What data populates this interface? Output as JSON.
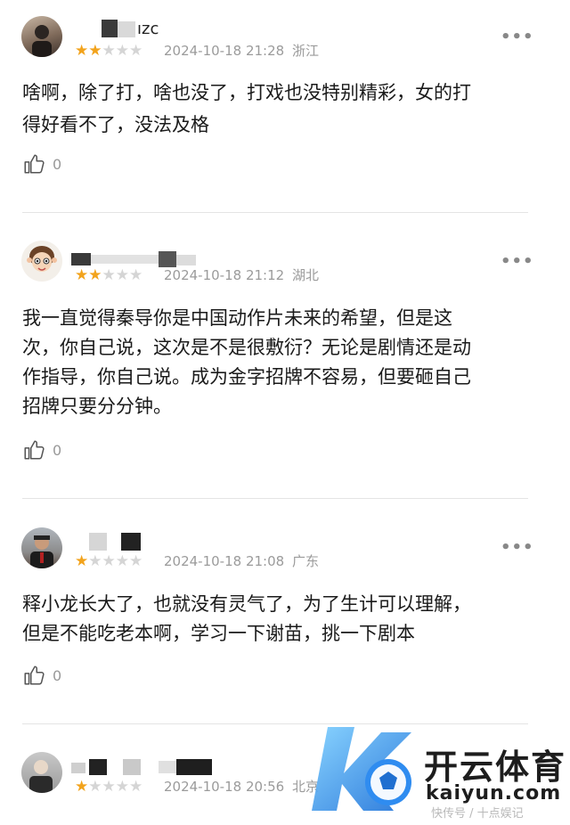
{
  "comments": [
    {
      "avatar": "avatar-photo",
      "stars": 2,
      "name_suffix": "ızc",
      "timestamp": "2024-10-18 21:28",
      "location": "浙江",
      "text_lines": [
        "啥啊，除了打，啥也没了，打戏也没特别精彩，女的打",
        "得好看不了，没法及格"
      ],
      "likes": "0"
    },
    {
      "avatar": "avatar-cartoon",
      "stars": 2,
      "name_suffix": "",
      "timestamp": "2024-10-18 21:12",
      "location": "湖北",
      "text_lines": [
        "我一直觉得秦导你是中国动作片未来的希望，但是这",
        "次，你自己说，这次是不是很敷衍？无论是剧情还是动",
        "作指导，你自己说。成为金字招牌不容易，但要砸自己",
        "招牌只要分分钟。"
      ],
      "likes": "0"
    },
    {
      "avatar": "avatar-photo",
      "stars": 1,
      "name_suffix": "",
      "timestamp": "2024-10-18 21:08",
      "location": "广东",
      "text_lines": [
        "释小龙长大了，也就没有灵气了，为了生计可以理解，",
        "但是不能吃老本啊，学习一下谢苗，挑一下剧本"
      ],
      "likes": "0"
    },
    {
      "avatar": "avatar-photo",
      "stars": 1,
      "name_suffix": "",
      "timestamp": "2024-10-18 20:56",
      "location": "北京",
      "text_lines": [],
      "likes": ""
    }
  ],
  "more_label": "•••",
  "watermark": {
    "brand_cn": "开云体育",
    "brand_en": "kaiyun.com",
    "source": "快传号 / 十点娱记"
  }
}
